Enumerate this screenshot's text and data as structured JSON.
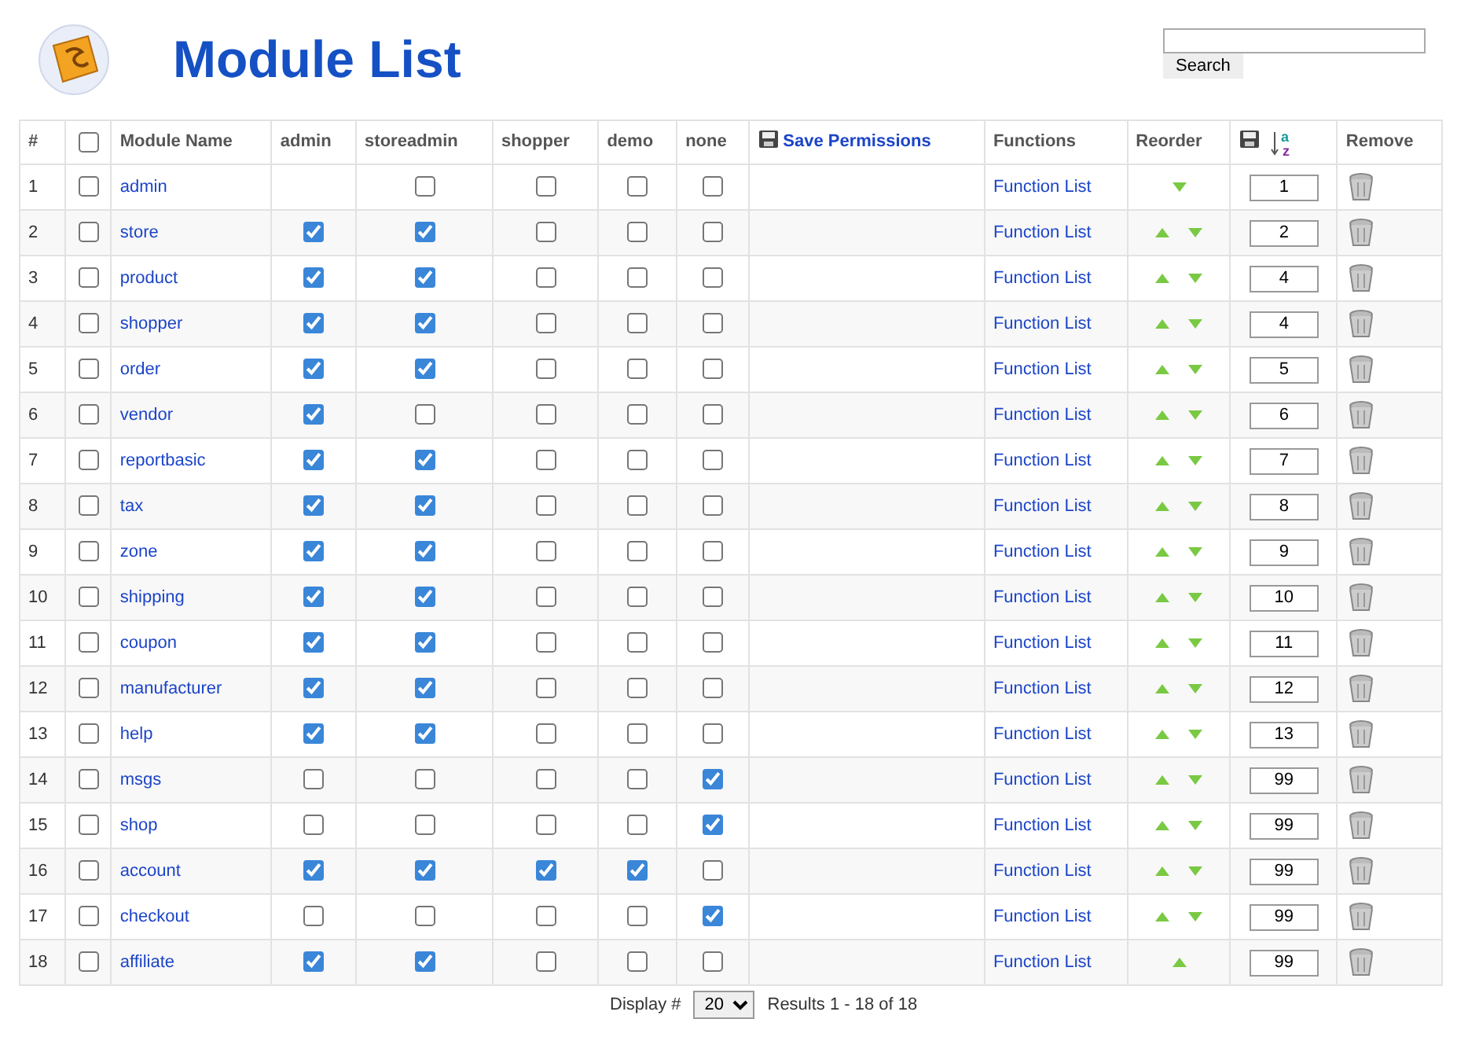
{
  "header": {
    "title": "Module List",
    "search": {
      "button": "Search"
    }
  },
  "table": {
    "columns": {
      "number": "#",
      "select_all": {
        "checked": false
      },
      "name": "Module Name",
      "groups": [
        "admin",
        "storeadmin",
        "shopper",
        "demo",
        "none"
      ],
      "save": "Save Permissions",
      "sort_letters": [
        "a",
        "z"
      ],
      "functions": "Functions",
      "reorder": "Reorder",
      "remove": "Remove"
    },
    "rows": [
      {
        "number": "1",
        "checked": false,
        "name": "admin",
        "perms": [
          {
            "kind": "blank"
          },
          false,
          false,
          false,
          false
        ],
        "functions": "Function List",
        "up": false,
        "down": true,
        "order": "1"
      },
      {
        "number": "2",
        "checked": false,
        "name": "store",
        "perms": [
          true,
          true,
          false,
          false,
          false
        ],
        "functions": "Function List",
        "up": true,
        "down": true,
        "order": "2"
      },
      {
        "number": "3",
        "checked": false,
        "name": "product",
        "perms": [
          true,
          true,
          false,
          false,
          false
        ],
        "functions": "Function List",
        "up": true,
        "down": true,
        "order": "4"
      },
      {
        "number": "4",
        "checked": false,
        "name": "shopper",
        "perms": [
          true,
          true,
          false,
          false,
          false
        ],
        "functions": "Function List",
        "up": true,
        "down": true,
        "order": "4"
      },
      {
        "number": "5",
        "checked": false,
        "name": "order",
        "perms": [
          true,
          true,
          false,
          false,
          false
        ],
        "functions": "Function List",
        "up": true,
        "down": true,
        "order": "5"
      },
      {
        "number": "6",
        "checked": false,
        "name": "vendor",
        "perms": [
          true,
          false,
          false,
          false,
          false
        ],
        "functions": "Function List",
        "up": true,
        "down": true,
        "order": "6"
      },
      {
        "number": "7",
        "checked": false,
        "name": "reportbasic",
        "perms": [
          true,
          true,
          false,
          false,
          false
        ],
        "functions": "Function List",
        "up": true,
        "down": true,
        "order": "7"
      },
      {
        "number": "8",
        "checked": false,
        "name": "tax",
        "perms": [
          true,
          true,
          false,
          false,
          false
        ],
        "functions": "Function List",
        "up": true,
        "down": true,
        "order": "8"
      },
      {
        "number": "9",
        "checked": false,
        "name": "zone",
        "perms": [
          true,
          true,
          false,
          false,
          false
        ],
        "functions": "Function List",
        "up": true,
        "down": true,
        "order": "9"
      },
      {
        "number": "10",
        "checked": false,
        "name": "shipping",
        "perms": [
          true,
          true,
          false,
          false,
          false
        ],
        "functions": "Function List",
        "up": true,
        "down": true,
        "order": "10"
      },
      {
        "number": "11",
        "checked": false,
        "name": "coupon",
        "perms": [
          true,
          true,
          false,
          false,
          false
        ],
        "functions": "Function List",
        "up": true,
        "down": true,
        "order": "11"
      },
      {
        "number": "12",
        "checked": false,
        "name": "manufacturer",
        "perms": [
          true,
          true,
          false,
          false,
          false
        ],
        "functions": "Function List",
        "up": true,
        "down": true,
        "order": "12"
      },
      {
        "number": "13",
        "checked": false,
        "name": "help",
        "perms": [
          true,
          true,
          false,
          false,
          false
        ],
        "functions": "Function List",
        "up": true,
        "down": true,
        "order": "13"
      },
      {
        "number": "14",
        "checked": false,
        "name": "msgs",
        "perms": [
          false,
          false,
          false,
          false,
          true
        ],
        "functions": "Function List",
        "up": true,
        "down": true,
        "order": "99"
      },
      {
        "number": "15",
        "checked": false,
        "name": "shop",
        "perms": [
          false,
          false,
          false,
          false,
          true
        ],
        "functions": "Function List",
        "up": true,
        "down": true,
        "order": "99"
      },
      {
        "number": "16",
        "checked": false,
        "name": "account",
        "perms": [
          true,
          true,
          true,
          true,
          false
        ],
        "functions": "Function List",
        "up": true,
        "down": true,
        "order": "99"
      },
      {
        "number": "17",
        "checked": false,
        "name": "checkout",
        "perms": [
          false,
          false,
          false,
          false,
          true
        ],
        "functions": "Function List",
        "up": true,
        "down": true,
        "order": "99"
      },
      {
        "number": "18",
        "checked": false,
        "name": "affiliate",
        "perms": [
          true,
          true,
          false,
          false,
          false
        ],
        "functions": "Function List",
        "up": true,
        "down": false,
        "order": "99"
      }
    ]
  },
  "footer": {
    "display_label": "Display #",
    "display_value": "20",
    "results": "Results 1 - 18 of 18"
  }
}
